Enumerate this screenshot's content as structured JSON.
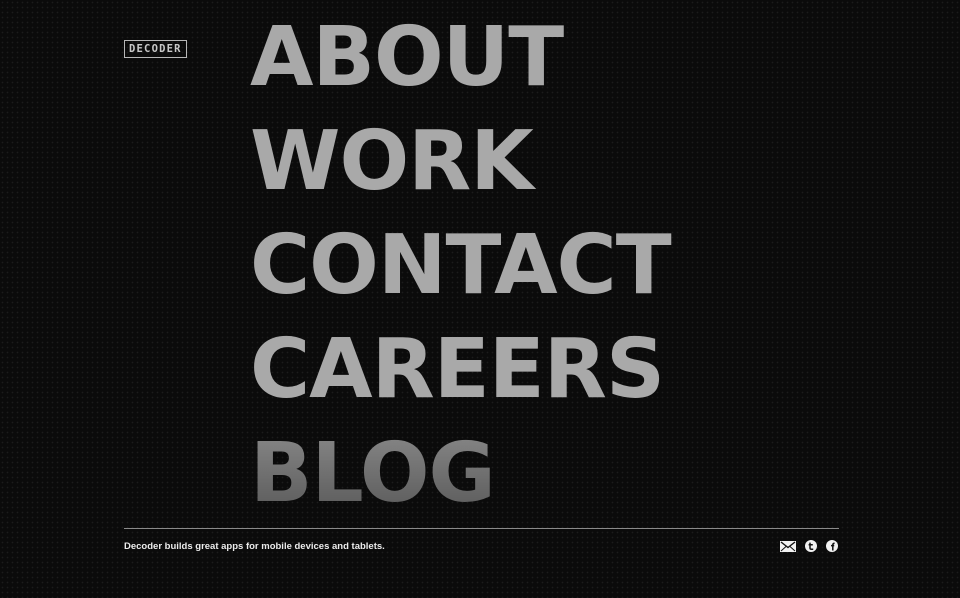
{
  "header": {
    "logo_text": "DECODER"
  },
  "nav": {
    "items": [
      {
        "label": "ABOUT"
      },
      {
        "label": "WORK"
      },
      {
        "label": "CONTACT"
      },
      {
        "label": "CAREERS"
      },
      {
        "label": "BLOG"
      }
    ]
  },
  "footer": {
    "tagline": "Decoder builds great apps for mobile devices and tablets.",
    "social_icons": [
      "mail-icon",
      "twitter-icon",
      "facebook-icon"
    ]
  },
  "colors": {
    "background": "#0b0b0b",
    "nav_text": "#a9a9a9",
    "tagline_text": "#ececec"
  }
}
